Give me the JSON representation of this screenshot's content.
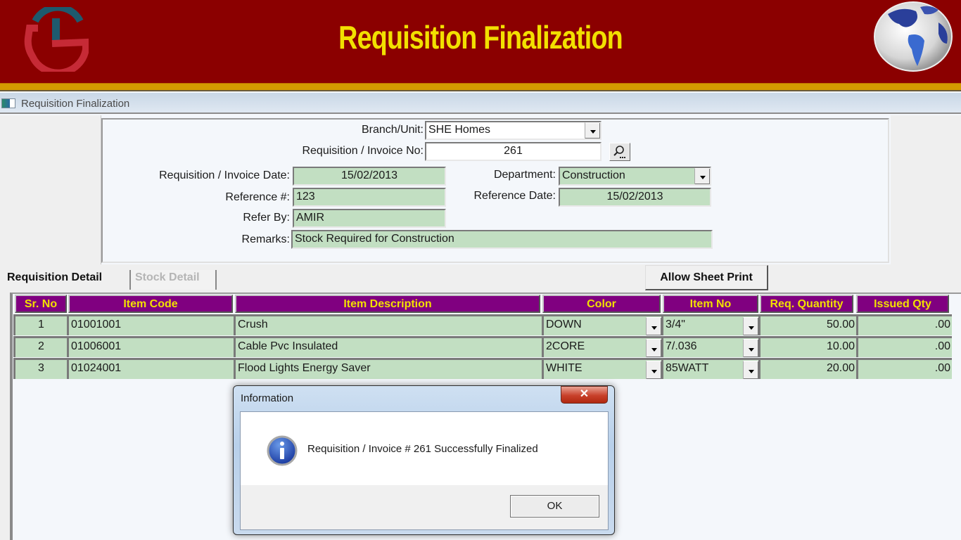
{
  "banner": {
    "title": "Requisition Finalization",
    "logo_icon": "ts-logo-icon",
    "globe_icon": "globe-icon",
    "colors": {
      "background": "#8b0000",
      "title": "#f2e000",
      "stripe": "#d49a00"
    }
  },
  "window": {
    "title": "Requisition Finalization",
    "icon": "app-window-icon"
  },
  "form": {
    "branch_unit": {
      "label": "Branch/Unit:",
      "value": "SHE Homes"
    },
    "invoice_no": {
      "label": "Requisition / Invoice No:",
      "value": "261"
    },
    "invoice_date": {
      "label": "Requisition / Invoice Date:",
      "value": "15/02/2013"
    },
    "department": {
      "label": "Department:",
      "value": "Construction"
    },
    "reference_no": {
      "label": "Reference #:",
      "value": "123"
    },
    "reference_date": {
      "label": "Reference Date:",
      "value": "15/02/2013"
    },
    "refer_by": {
      "label": "Refer By:",
      "value": "AMIR"
    },
    "remarks": {
      "label": "Remarks:",
      "value": "Stock Required for Construction"
    },
    "search_icon": "search-icon"
  },
  "tabs": [
    {
      "label": "Requisition Detail",
      "active": true
    },
    {
      "label": "Stock Detail",
      "active": false
    }
  ],
  "toolbar": {
    "allow_sheet_print": "Allow Sheet Print"
  },
  "grid": {
    "columns": [
      "Sr. No",
      "Item Code",
      "Item Description",
      "Color",
      "Item No",
      "Req. Quantity",
      "Issued Qty"
    ],
    "rows": [
      {
        "sr": "1",
        "code": "01001001",
        "description": "Crush",
        "color": "DOWN",
        "item_no": "3/4\"",
        "req_qty": "50.00",
        "issued_qty": ".00"
      },
      {
        "sr": "2",
        "code": "01006001",
        "description": "Cable Pvc Insulated",
        "color": "2CORE",
        "item_no": "7/.036",
        "req_qty": "10.00",
        "issued_qty": ".00"
      },
      {
        "sr": "3",
        "code": "01024001",
        "description": "Flood Lights Energy Saver",
        "color": "WHITE",
        "item_no": "85WATT",
        "req_qty": "20.00",
        "issued_qty": ".00"
      }
    ],
    "colors": {
      "header_bg": "#800080",
      "header_text": "#f2e000",
      "cell_bg": "#c2dfc2"
    }
  },
  "dialog": {
    "title": "Information",
    "message": "Requisition / Invoice # 261 Successfully Finalized",
    "ok_label": "OK",
    "close_label": "✕",
    "icon": "info-icon"
  }
}
